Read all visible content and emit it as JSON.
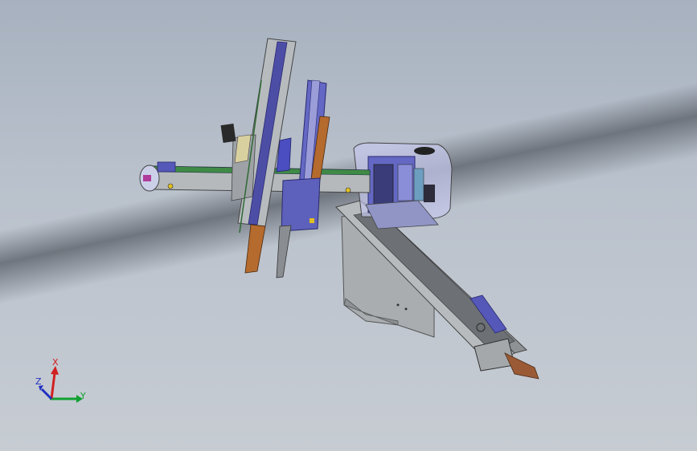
{
  "scene": {
    "colors": {
      "background_top": "#a7b1bf",
      "background_bottom": "#c7ccd3",
      "frame_gray": "#9ea3a8",
      "rail_blue": "#5558b8",
      "cylinder_orange": "#b56a2e",
      "guard_lilac": "#b9bce0",
      "wood_strip": "#9a5a35"
    }
  },
  "triad": {
    "x_label": "X",
    "y_label": "Y",
    "z_label": "Z",
    "x_color": "#d02020",
    "y_color": "#10a030",
    "z_color": "#2030c0"
  }
}
